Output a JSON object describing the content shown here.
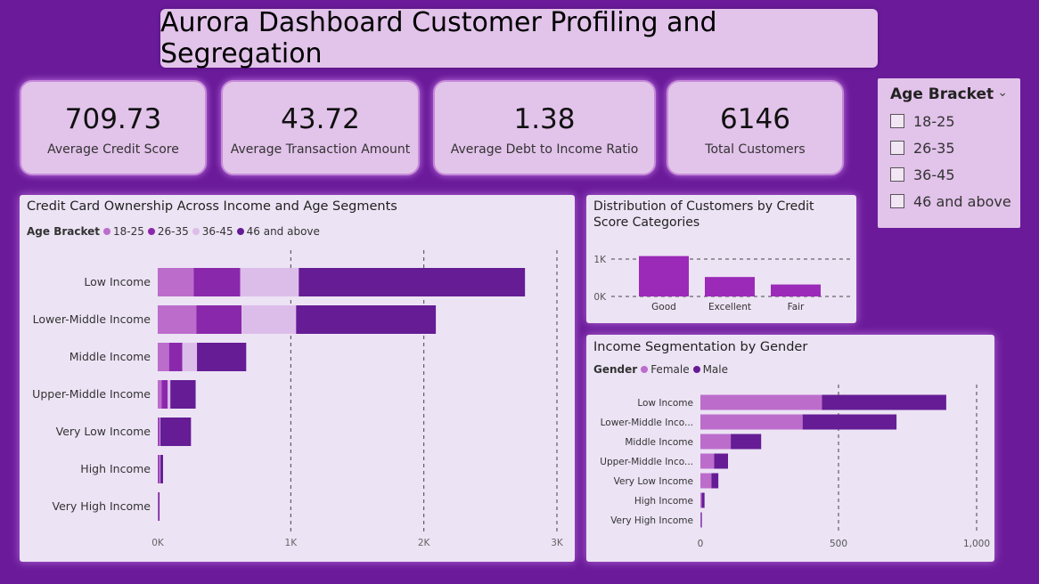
{
  "header": {
    "title": "Aurora Dashboard Customer Profiling and Segregation"
  },
  "kpis": [
    {
      "value": "709.73",
      "label": "Average Credit Score"
    },
    {
      "value": "43.72",
      "label": "Average Transaction Amount"
    },
    {
      "value": "1.38",
      "label": "Average Debt to Income Ratio"
    },
    {
      "value": "6146",
      "label": "Total Customers"
    }
  ],
  "slicer": {
    "title": "Age Bracket",
    "options": [
      "18-25",
      "26-35",
      "36-45",
      "46 and above"
    ]
  },
  "colors": {
    "c18_25": "#bc6dcc",
    "c26_35": "#8a28ac",
    "c36_45": "#dcbde9",
    "c46": "#651c95",
    "female": "#bc6dcc",
    "male": "#651c95",
    "credit_bar": "#9b2ab8"
  },
  "chart_data": [
    {
      "type": "bar",
      "orientation": "horizontal",
      "stacked": true,
      "title": "Credit Card Ownership Across Income and Age Segments",
      "legend_title": "Age Bracket",
      "categories": [
        "Low Income",
        "Lower-Middle Income",
        "Middle Income",
        "Upper-Middle Income",
        "Very Low Income",
        "High Income",
        "Very High Income"
      ],
      "series": [
        {
          "name": "18-25",
          "values": [
            270,
            290,
            85,
            30,
            5,
            5,
            2
          ]
        },
        {
          "name": "26-35",
          "values": [
            350,
            340,
            100,
            45,
            10,
            10,
            3
          ]
        },
        {
          "name": "36-45",
          "values": [
            440,
            410,
            110,
            20,
            5,
            5,
            2
          ]
        },
        {
          "name": "46 and above",
          "values": [
            1700,
            1050,
            370,
            190,
            230,
            20,
            5
          ]
        }
      ],
      "xticks": [
        "0K",
        "1K",
        "2K",
        "3K"
      ],
      "xlim": [
        0,
        3000
      ],
      "grid": true
    },
    {
      "type": "bar",
      "title": "Distribution of Customers by Credit Score Categories",
      "categories": [
        "Good",
        "Excellent",
        "Fair"
      ],
      "values": [
        1080,
        520,
        320
      ],
      "yticks": [
        "1K",
        "0K"
      ],
      "ylim": [
        0,
        1000
      ],
      "grid": true
    },
    {
      "type": "bar",
      "orientation": "horizontal",
      "stacked": true,
      "title": "Income Segmentation by Gender",
      "legend_title": "Gender",
      "categories": [
        "Low Income",
        "Lower-Middle Inco...",
        "Middle Income",
        "Upper-Middle Inco...",
        "Very Low Income",
        "High Income",
        "Very High Income"
      ],
      "series": [
        {
          "name": "Female",
          "values": [
            440,
            370,
            110,
            50,
            40,
            5,
            2
          ]
        },
        {
          "name": "Male",
          "values": [
            450,
            340,
            110,
            50,
            25,
            10,
            3
          ]
        }
      ],
      "xticks": [
        "0",
        "500",
        "1,000"
      ],
      "xlim": [
        0,
        1000
      ],
      "grid": true
    }
  ]
}
